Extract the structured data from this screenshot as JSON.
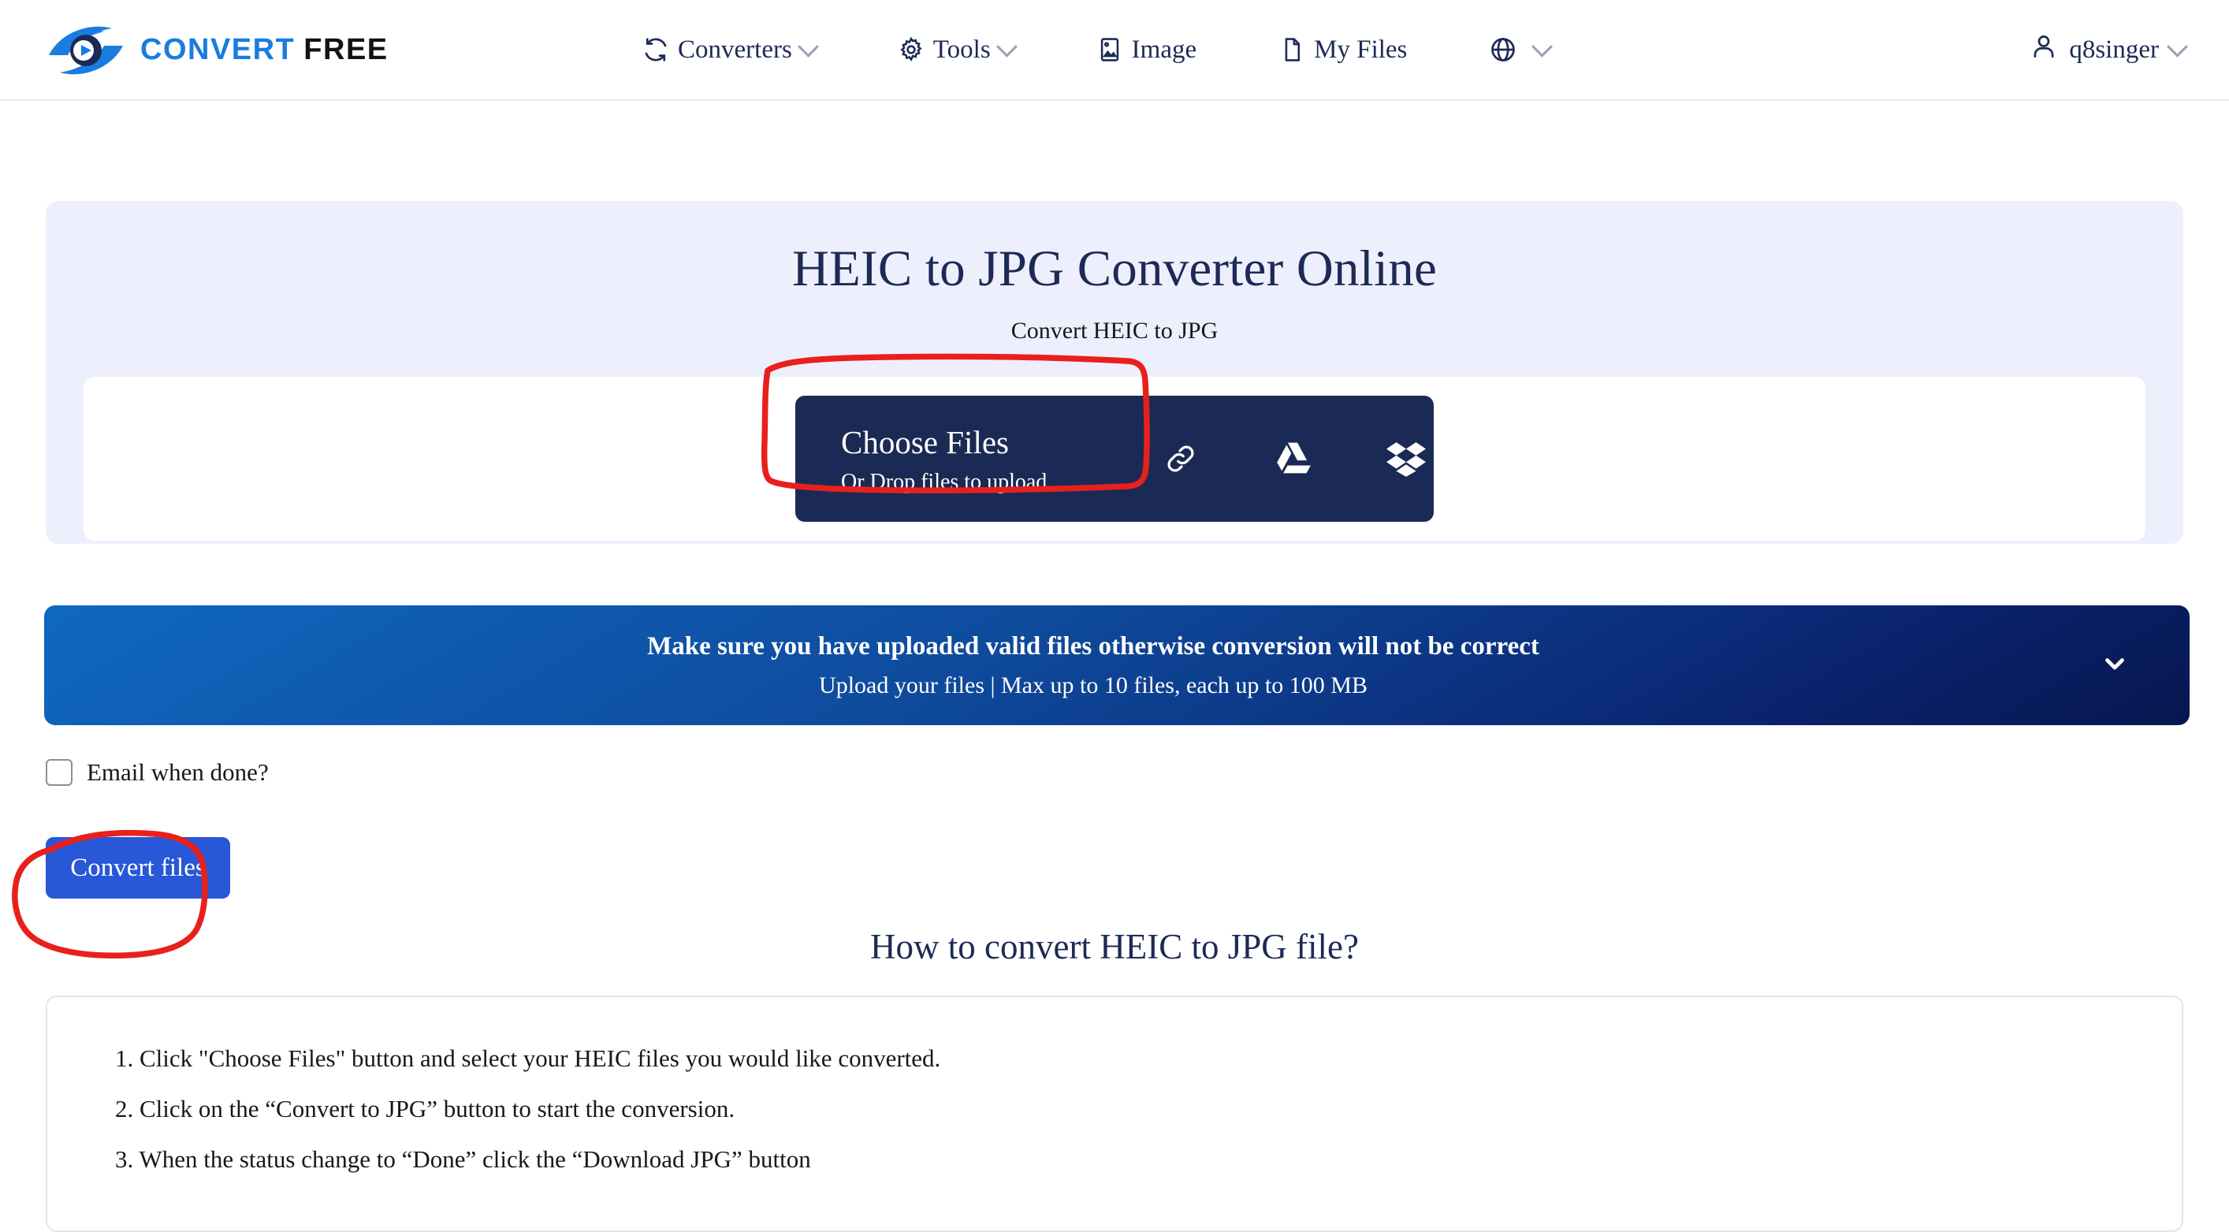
{
  "header": {
    "logo": {
      "part1": "CONVERT",
      "part2": "FREE",
      "icon": "convertfree-eye-logo"
    },
    "nav": [
      {
        "label": "Converters",
        "icon": "refresh-icon",
        "has_chevron": true
      },
      {
        "label": "Tools",
        "icon": "gear-icon",
        "has_chevron": true
      },
      {
        "label": "Image",
        "icon": "image-icon",
        "has_chevron": false
      },
      {
        "label": "My Files",
        "icon": "file-icon",
        "has_chevron": false
      },
      {
        "label": "",
        "icon": "globe-icon",
        "has_chevron": true
      }
    ],
    "user": {
      "name": "q8singer",
      "icon": "user-icon",
      "has_chevron": true
    }
  },
  "hero": {
    "title": "HEIC to JPG Converter Online",
    "subtitle": "Convert HEIC to JPG",
    "choose_button": {
      "main_label": "Choose Files",
      "sub_label": "Or Drop files to upload",
      "cloud_sources": [
        "link-icon",
        "google-drive-icon",
        "dropbox-icon"
      ]
    }
  },
  "notice": {
    "line1": "Make sure you have uploaded valid files otherwise conversion will not be correct",
    "line2": "Upload your files | Max up to 10 files, each up to 100 MB",
    "expand_icon": "chevron-down-icon"
  },
  "options": {
    "email_label": "Email when done?",
    "email_checked": false,
    "convert_label": "Convert files"
  },
  "howto": {
    "title": "How to convert HEIC to JPG file?",
    "steps": [
      "1. Click \"Choose Files\" button and select your HEIC files you would like converted.",
      "2. Click on the “Convert to JPG” button to start the conversion.",
      "3. When the status change to “Done” click the “Download JPG” button"
    ]
  },
  "colors": {
    "brand_blue": "#1a7ce0",
    "navy": "#1b2a54",
    "hero_bg": "#eeeffc",
    "button_blue": "#2857d8",
    "annotation_red": "#e8201c"
  }
}
